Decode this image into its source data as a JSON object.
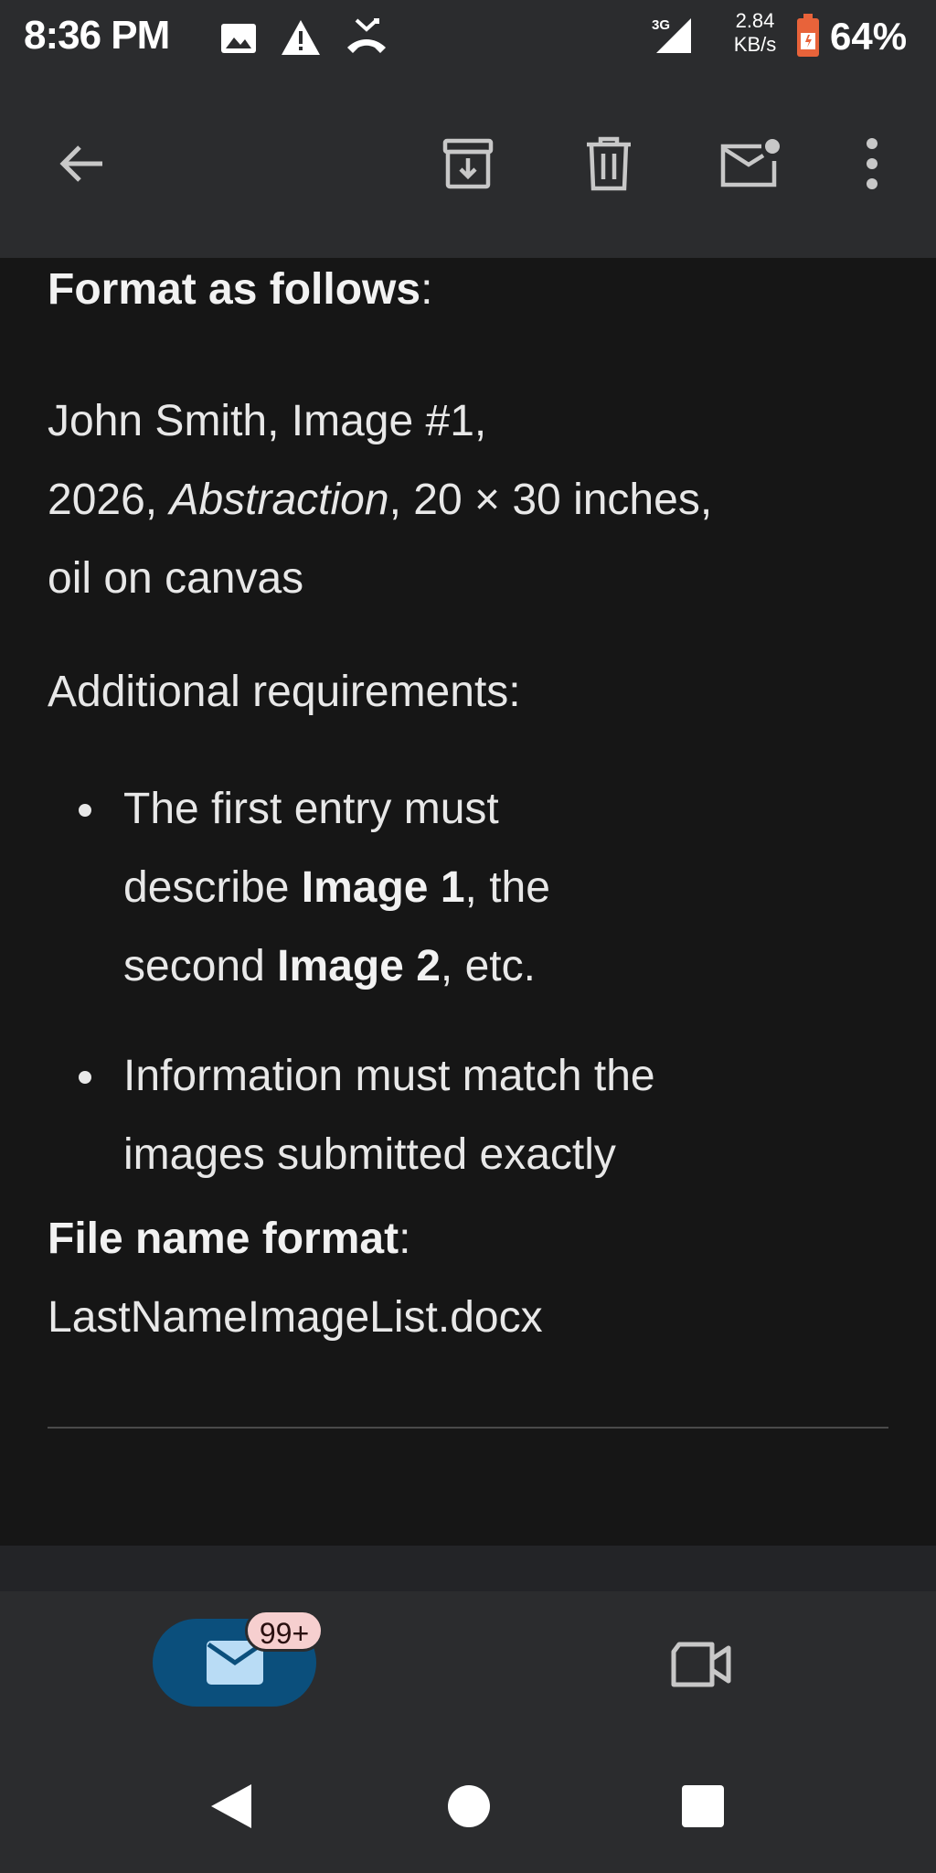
{
  "status_bar": {
    "time": "8:36 PM",
    "icons": [
      "image-icon",
      "alert-triangle-icon",
      "missed-call-icon"
    ],
    "network": "3G",
    "net_speed_value": "2.84",
    "net_speed_unit": "KB/s",
    "battery_percent": "64%",
    "battery_color": "#e8633a"
  },
  "app_bar": {
    "back_icon": "arrow-left-icon",
    "actions": [
      "archive-icon",
      "trash-icon",
      "mark-unread-icon",
      "more-vert-icon"
    ]
  },
  "email": {
    "format_heading": "Format as follows",
    "format_heading_suffix": ":",
    "example_part1": "John Smith, Image #1,",
    "example_part2": "2026, ",
    "example_title": "Abstraction",
    "example_part3": ", 20 × 30 inches,",
    "example_part4": "oil on canvas",
    "additional_req": "Additional requirements:",
    "bullet1_line1": "The first entry must",
    "bullet1_line2_pre": "describe ",
    "bullet1_line2_bold": "Image 1",
    "bullet1_line2_post": ", the",
    "bullet1_line3_pre": "second ",
    "bullet1_line3_bold": "Image 2",
    "bullet1_line3_post": ", etc.",
    "bullet2_line1": "Information must match the",
    "bullet2_line2": "images submitted exactly",
    "filename_heading": "File name format",
    "filename_heading_suffix": ":",
    "filename_value": "LastNameImageList.docx"
  },
  "bottom_nav": {
    "mail_badge": "99+",
    "mail_icon": "mail-icon",
    "meet_icon": "video-camera-icon",
    "accent_color": "#0b4f7c"
  },
  "system_nav": {
    "buttons": [
      "back-triangle-icon",
      "home-circle-icon",
      "recents-square-icon"
    ]
  }
}
